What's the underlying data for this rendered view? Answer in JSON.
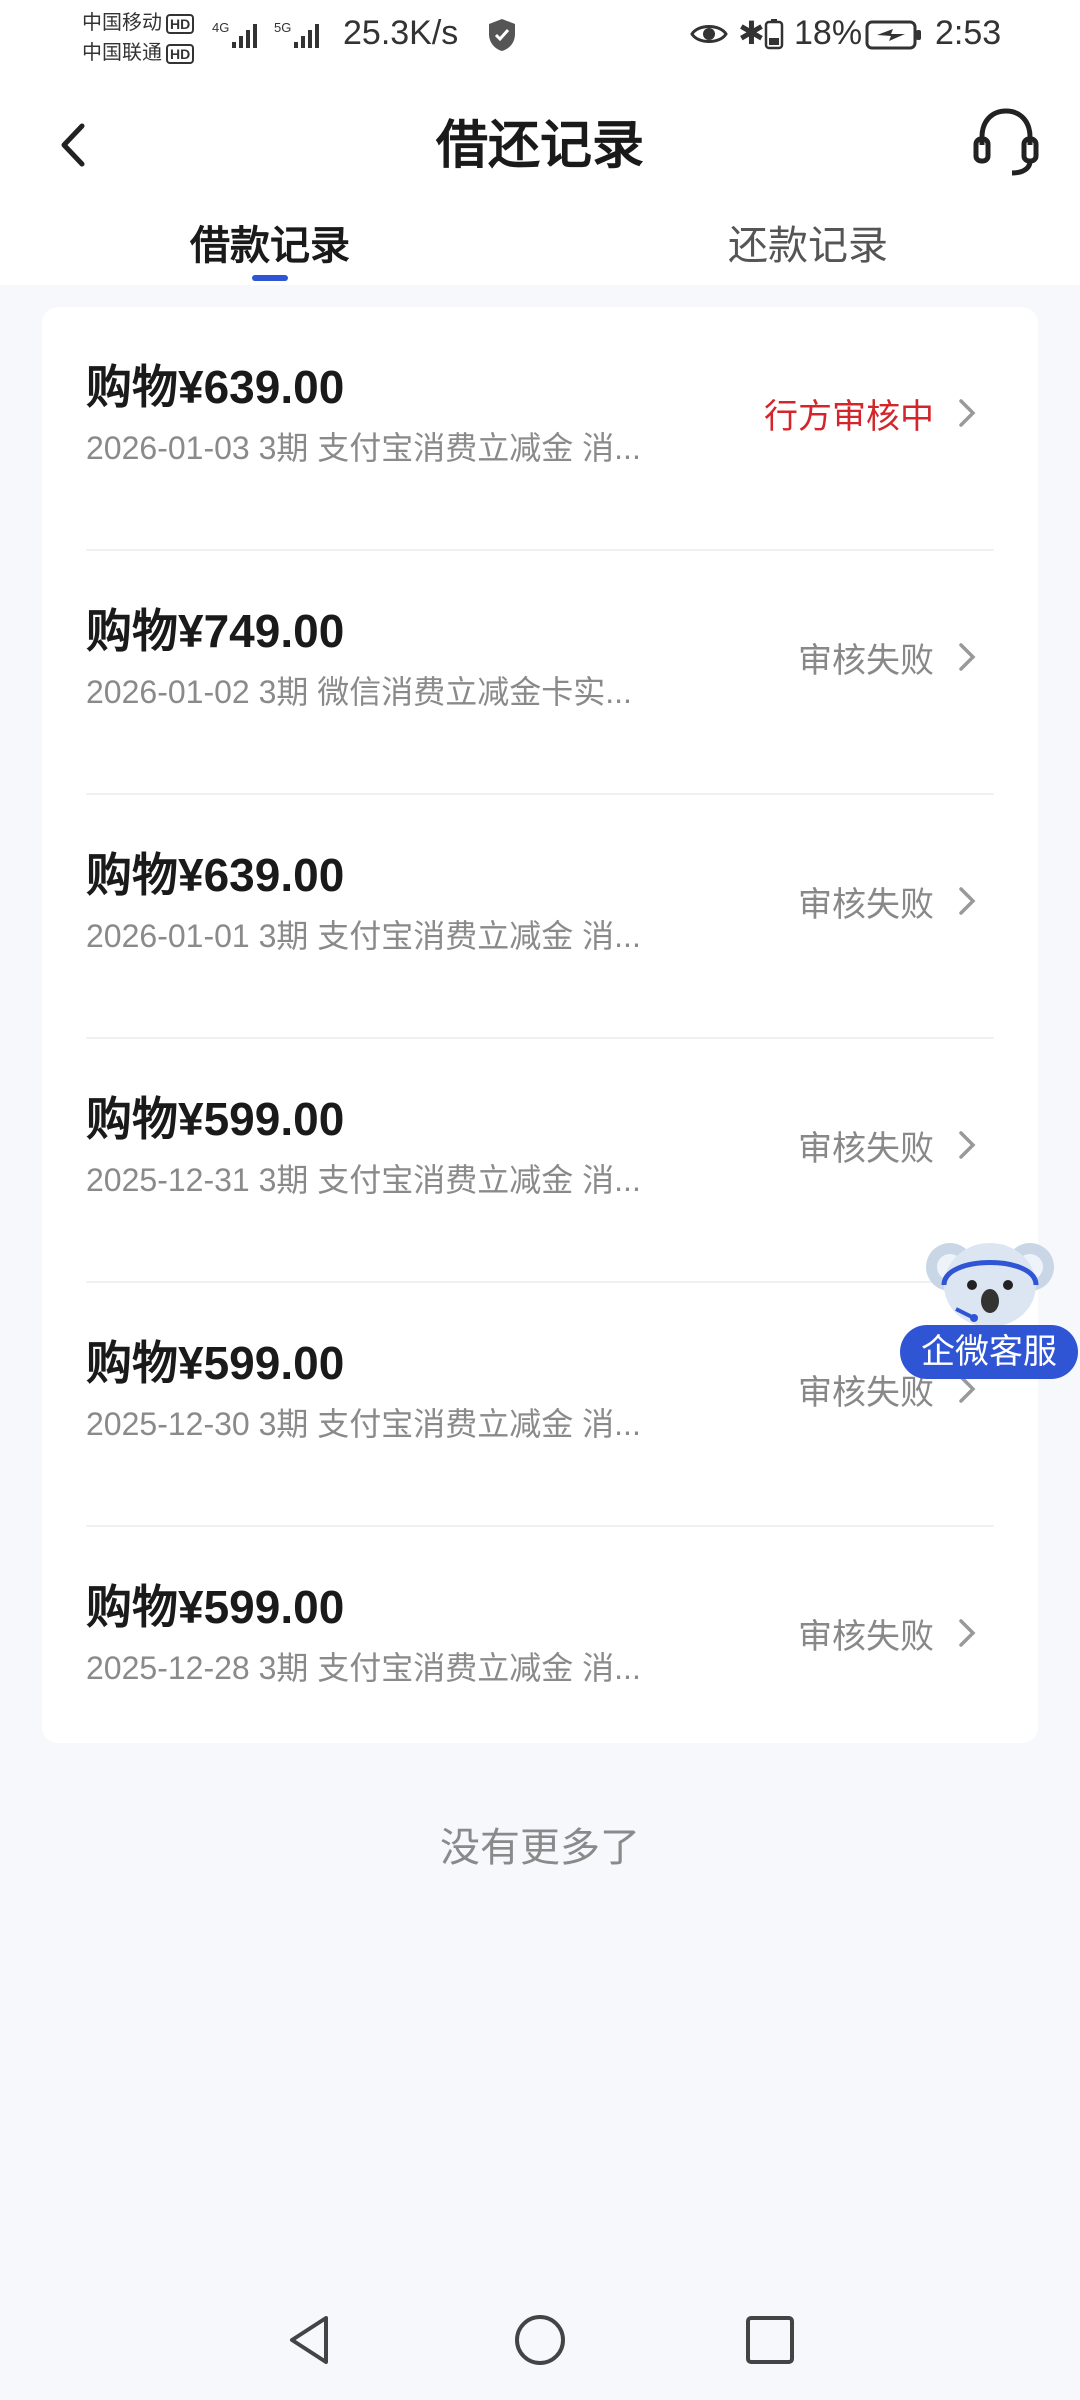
{
  "status_bar": {
    "carrier1": "中国移动",
    "carrier2": "中国联通",
    "hd": "HD",
    "net1": "4G",
    "net2": "5G",
    "speed": "25.3K/s",
    "battery_percent": "18%",
    "time": "2:53"
  },
  "header": {
    "title": "借还记录",
    "tabs": [
      {
        "label": "借款记录",
        "active": true
      },
      {
        "label": "还款记录",
        "active": false
      }
    ]
  },
  "records": [
    {
      "amount": "购物¥639.00",
      "subtitle": "2026-01-03 3期  支付宝消费立减金 消...",
      "status": "行方审核中",
      "status_type": "pending"
    },
    {
      "amount": "购物¥749.00",
      "subtitle": "2026-01-02 3期  微信消费立减金卡实...",
      "status": "审核失败",
      "status_type": "failed"
    },
    {
      "amount": "购物¥639.00",
      "subtitle": "2026-01-01 3期  支付宝消费立减金 消...",
      "status": "审核失败",
      "status_type": "failed"
    },
    {
      "amount": "购物¥599.00",
      "subtitle": "2025-12-31 3期  支付宝消费立减金 消...",
      "status": "审核失败",
      "status_type": "failed"
    },
    {
      "amount": "购物¥599.00",
      "subtitle": "2025-12-30 3期  支付宝消费立减金 消...",
      "status": "审核失败",
      "status_type": "failed"
    },
    {
      "amount": "购物¥599.00",
      "subtitle": "2025-12-28 3期  支付宝消费立减金 消...",
      "status": "审核失败",
      "status_type": "failed"
    }
  ],
  "footer_text": "没有更多了",
  "floating_service": {
    "label": "企微客服"
  },
  "colors": {
    "accent": "#2f55d4",
    "pending": "#d4262a",
    "failed": "#888888",
    "background": "#f6f8fc"
  },
  "icons": {
    "back": "chevron-left-icon",
    "service": "headset-icon",
    "row_arrow": "chevron-right-icon",
    "nav_back": "triangle-back-icon",
    "nav_home": "circle-home-icon",
    "nav_recent": "square-recent-icon"
  }
}
